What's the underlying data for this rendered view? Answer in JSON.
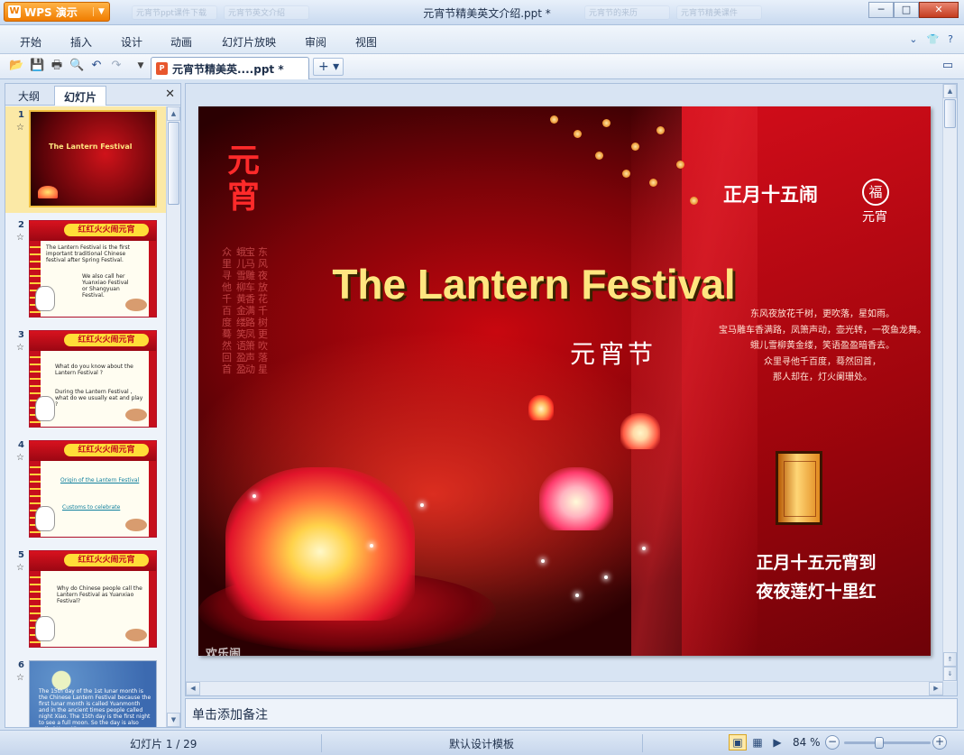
{
  "app": {
    "button_label": "WPS 演示",
    "window_title": "元宵节精美英文介绍.ppt *",
    "background_tabs": [
      "元宵节ppt课件下载",
      "元宵节英文介绍",
      "元宵节的来历",
      "元宵节精美课件"
    ],
    "window_controls": {
      "minimize": "─",
      "maximize": "□",
      "close": "✕"
    }
  },
  "menu": {
    "items": [
      "开始",
      "插入",
      "设计",
      "动画",
      "幻灯片放映",
      "审阅",
      "视图"
    ],
    "right": {
      "collapse": "⌄",
      "skin": "👕",
      "help": "?"
    }
  },
  "toolbar": {
    "icons": [
      "open-icon",
      "save-icon",
      "print-icon",
      "print-preview-icon",
      "undo-icon",
      "redo-icon",
      "customize-icon"
    ],
    "doc_tab": {
      "label": "元宵节精美英....ppt *",
      "icon": "P"
    },
    "new_tab_label": "+ ▾",
    "restore_icon": "▭"
  },
  "left_panel": {
    "tabs": {
      "outline": "大纲",
      "slides": "幻灯片"
    },
    "close": "✕",
    "thumbnails": [
      {
        "num": "1",
        "star": "☆",
        "kind": "title",
        "title": "The Lantern Festival"
      },
      {
        "num": "2",
        "star": "☆",
        "kind": "festive",
        "lines": [
          "The Lantern Festival is the first important traditional Chinese festival after Spring Festival.",
          "We also call her Yuanxiao Festival or Shangyuan Festival."
        ]
      },
      {
        "num": "3",
        "star": "☆",
        "kind": "festive",
        "lines": [
          "What do you know about the Lantern Festival ?",
          "During the Lantern Festival , what do we usually eat and play ?"
        ]
      },
      {
        "num": "4",
        "star": "☆",
        "kind": "festive",
        "lines": [
          "Origin of the Lantern Festival",
          "Customs to celebrate"
        ]
      },
      {
        "num": "5",
        "star": "☆",
        "kind": "festive",
        "lines": [
          "Why do Chinese people call the Lantern Festival as Yuanxiao Festival?"
        ]
      },
      {
        "num": "6",
        "star": "☆",
        "kind": "blue",
        "lines": [
          "The 15th day of the 1st lunar month is the Chinese Lantern Festival because the first lunar month is called Yuanmonth and in the ancient times people called night Xiao. The 15th day is the first night to see a full moon. So the day is also called Yuan Xiao."
        ]
      }
    ],
    "banner_text": "红红火火闹元宵"
  },
  "slide": {
    "title": "The Lantern Festival",
    "cn_title": "元宵节",
    "vertical_title": "元宵",
    "motto": "正月十五闹",
    "motto_fu": "福",
    "motto_sub": "元宵",
    "poem": [
      "东风夜放花千树，更吹落，星如雨。",
      "宝马雕车香满路，凤箫声动，壶光转，一夜鱼龙舞。",
      "蛾儿雪柳黄金缕，笑语盈盈暗香去。",
      "众里寻他千百度，蓦然回首，",
      "那人却在，灯火阑珊处。"
    ],
    "couplet": [
      "正月十五元宵到",
      "夜夜莲灯十里红"
    ],
    "vertical_columns": [
      "众里寻他千百度蓦然回首",
      "蛾儿雪柳黄金缕笑语盈盈",
      "宝马雕车香满路凤箫声动",
      "东风夜放花千树更吹落星",
      "那人却在灯火阑珊处"
    ],
    "footer_fragment": "欢乐闹"
  },
  "notes": {
    "placeholder": "单击添加备注"
  },
  "status": {
    "slide_count": "幻灯片 1 / 29",
    "template": "默认设计模板",
    "zoom": "84 %",
    "zoom_level": 0.84,
    "view_icons": {
      "normal": "▣",
      "sorter": "▦",
      "show": "▶"
    }
  }
}
